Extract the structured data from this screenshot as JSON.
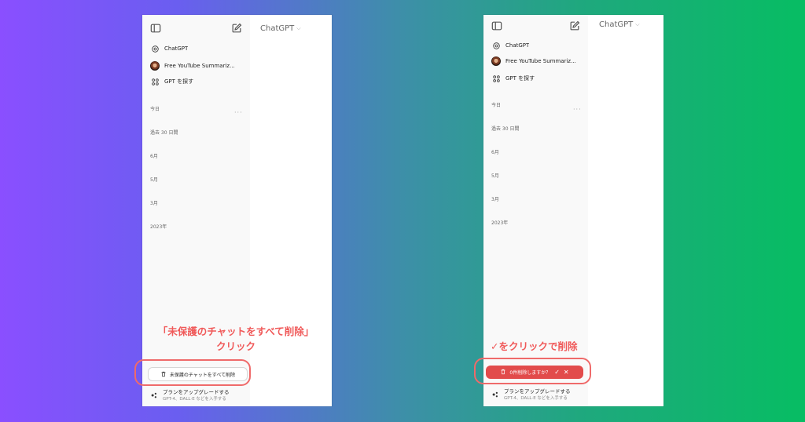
{
  "left_panel": {
    "app_title": "ChatGPT",
    "nav": [
      {
        "label": "ChatGPT",
        "icon": "openai-logo-icon"
      },
      {
        "label": "Free YouTube Summariz...",
        "icon": "avatar"
      },
      {
        "label": "GPT を探す",
        "icon": "grid-icon"
      }
    ],
    "sections": [
      "今日",
      "過去 30 日間",
      "6月",
      "5月",
      "3月",
      "2023年"
    ],
    "delete_button_label": "未保護のチャットをすべて削除",
    "upgrade_title": "プランをアップグレードする",
    "upgrade_subtitle": "GPT-4、DALL·E などを入手する"
  },
  "right_panel": {
    "app_title": "ChatGPT",
    "nav": [
      {
        "label": "ChatGPT",
        "icon": "openai-logo-icon"
      },
      {
        "label": "Free YouTube Summariz...",
        "icon": "avatar"
      },
      {
        "label": "GPT を探す",
        "icon": "grid-icon"
      }
    ],
    "sections": [
      "今日",
      "過去 30 日間",
      "6月",
      "5月",
      "3月",
      "2023年"
    ],
    "confirm_label": "0件削除しますか？",
    "confirm_check": "✓",
    "confirm_cancel": "✕",
    "upgrade_title": "プランをアップグレードする",
    "upgrade_subtitle": "GPT-4、DALL·E などを入手する"
  },
  "captions": {
    "left_line1": "「未保護のチャットをすべて削除」",
    "left_line2": "クリック",
    "right_line1": "✓をクリックで削除"
  },
  "colors": {
    "annotation": "#ef6a6a",
    "confirm_bg": "#e24b4b"
  }
}
